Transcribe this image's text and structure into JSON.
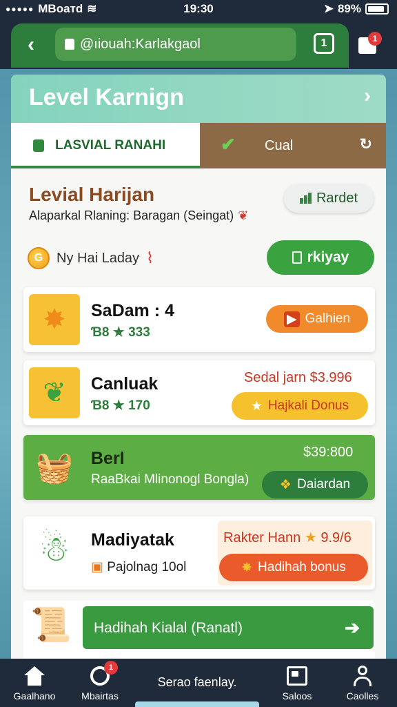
{
  "status_bar": {
    "carrier": "MBoaтd",
    "time": "19:30",
    "battery": "89%",
    "battery_level": 0.89
  },
  "browser": {
    "url": "@ıiouah:Karlakgaol",
    "tab_count": "1",
    "store_badge": "1"
  },
  "header": {
    "title": "Level Karnign"
  },
  "tabs": {
    "left": "LASVIAL RANAHI",
    "right": "Cual"
  },
  "section": {
    "title": "Levial Harijan",
    "subtitle": "Alaparkal Rlaning: Baragan (Seingat)",
    "rardet_button": "Rardet",
    "coin_label": "Ny Hai Laday",
    "daily_button": "rkiyay"
  },
  "items": [
    {
      "name": "SaDam : 4",
      "meta_prefix": "Ɓ8",
      "meta_value": "333",
      "button": "Galhien"
    },
    {
      "name": "Canluak",
      "meta_prefix": "Ɓ8",
      "meta_value": "170",
      "price": "Sedal jarn $3.996",
      "button": "Hajkali Donus"
    },
    {
      "name": "Berl",
      "subtitle": "RaaBkai Mlinonogl Bongla)",
      "price": "$39:800",
      "button": "Daiardan"
    },
    {
      "name": "Madiyatak",
      "subtitle": "Pajolnag 10ol",
      "price_label": "Rakter Hann",
      "price_value": "9.9/6",
      "button": "Hadihah bonus"
    }
  ],
  "banner": {
    "label": "Hadihah Kialal (Ranatl)"
  },
  "bottom_nav": {
    "home": "Gaalhano",
    "search": "Mbairtas",
    "search_badge": "1",
    "center": "Serao faenlay.",
    "docs": "Saloos",
    "profile": "Caolles"
  },
  "colors": {
    "primary_green": "#2d7d3c",
    "accent_orange": "#f08a2a",
    "header_teal": "#84d3bd",
    "tab_brown": "#8b6a45",
    "dark_bar": "#1f2a3a"
  }
}
